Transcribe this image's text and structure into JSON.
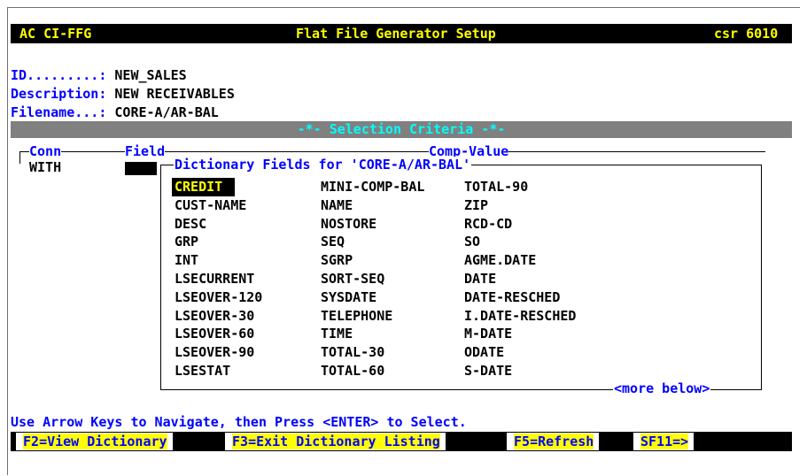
{
  "header": {
    "left": "AC CI-FFG",
    "title": "Flat File Generator Setup",
    "right": "csr 6010"
  },
  "info": {
    "id_label": "ID.........:",
    "id_value": "NEW_SALES",
    "desc_label": "Description:",
    "desc_value": "NEW RECEIVABLES",
    "file_label": "Filename...:",
    "file_value": "CORE-A/AR-BAL"
  },
  "selection_banner": "-*-  Selection Criteria  -*-",
  "columns": {
    "conn": "Conn",
    "field": "Field",
    "comp_value": "Comp-Value"
  },
  "conn_value": "WITH",
  "popup": {
    "title": "Dictionary Fields for 'CORE-A/AR-BAL'",
    "more": "<more below>",
    "col1": [
      "CREDIT",
      "CUST-NAME",
      "DESC",
      "GRP",
      "INT",
      "LSECURRENT",
      "LSEOVER-120",
      "LSEOVER-30",
      "LSEOVER-60",
      "LSEOVER-90",
      "LSESTAT"
    ],
    "col2": [
      "MINI-COMP-BAL",
      "NAME",
      "NOSTORE",
      "SEQ",
      "SGRP",
      "SORT-SEQ",
      "SYSDATE",
      "TELEPHONE",
      "TIME",
      "TOTAL-30",
      "TOTAL-60"
    ],
    "col3": [
      "TOTAL-90",
      "ZIP",
      "RCD-CD",
      "SO",
      "AGME.DATE",
      "DATE",
      "DATE-RESCHED",
      "I.DATE-RESCHED",
      "M-DATE",
      "ODATE",
      "S-DATE"
    ],
    "selected": "CREDIT"
  },
  "status": "Use Arrow Keys to Navigate, then Press <ENTER> to Select.",
  "fkeys": [
    {
      "key": "F2",
      "sep": "=",
      "label": "View Dictionary"
    },
    {
      "key": "F3",
      "sep": "=",
      "label": "Exit Dictionary Listing"
    },
    {
      "key": "F5",
      "sep": "=",
      "label": "Refresh"
    },
    {
      "key": "SF11",
      "sep": "=",
      "label": ">"
    }
  ]
}
